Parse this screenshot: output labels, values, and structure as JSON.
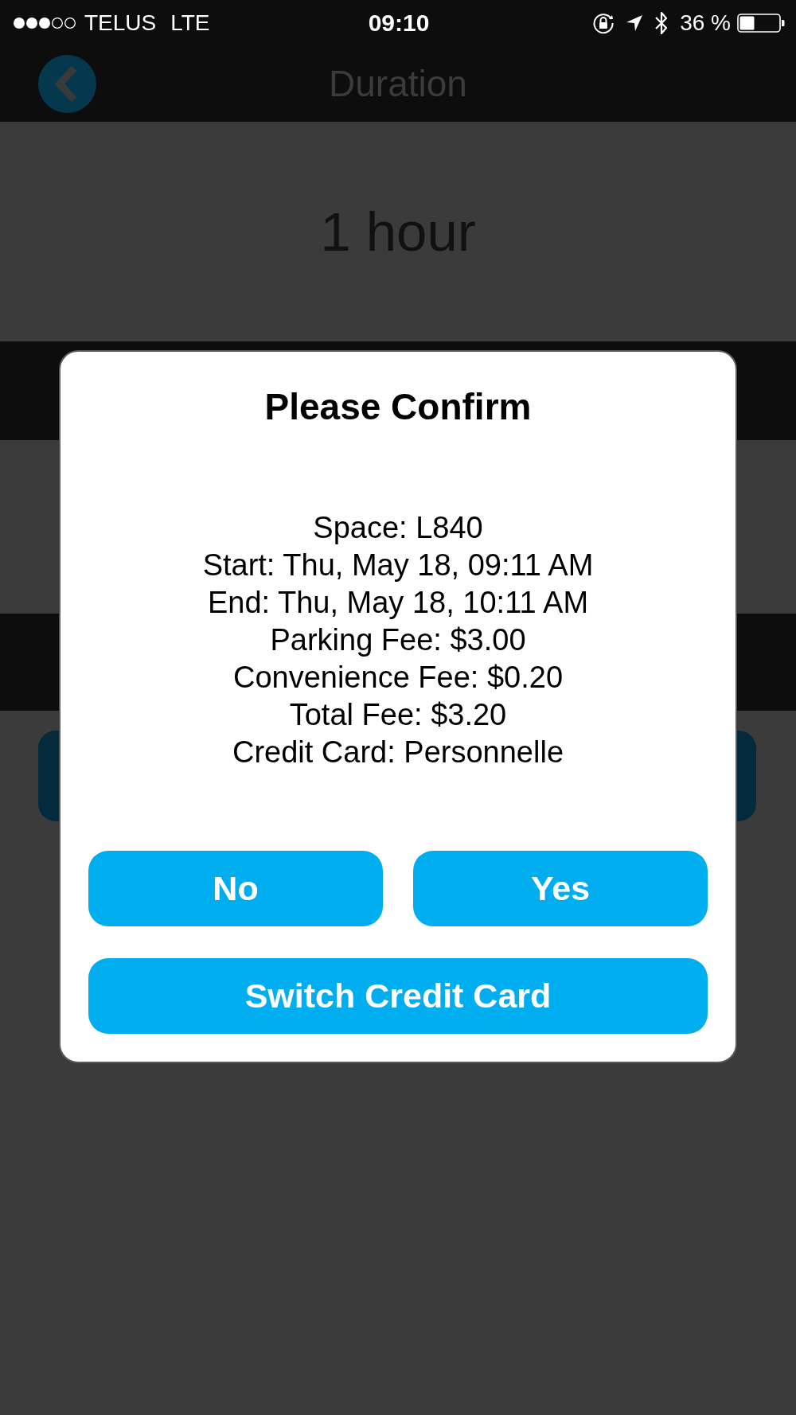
{
  "status_bar": {
    "carrier": "TELUS",
    "network": "LTE",
    "time": "09:10",
    "battery": "36 %"
  },
  "nav_bar": {
    "title": "Duration"
  },
  "duration": {
    "value": "1 hour"
  },
  "dialog": {
    "title": "Please Confirm",
    "lines": [
      "Space: L840",
      "Start: Thu, May 18, 09:11 AM",
      "End: Thu, May 18, 10:11 AM",
      "Parking Fee: $3.00",
      "Convenience Fee: $0.20",
      "Total Fee: $3.20",
      "Credit Card: Personnelle"
    ],
    "buttons": [
      {
        "label": "No",
        "kind": "half"
      },
      {
        "label": "Yes",
        "kind": "half"
      },
      {
        "label": "Switch Credit Card",
        "kind": "full"
      }
    ]
  }
}
